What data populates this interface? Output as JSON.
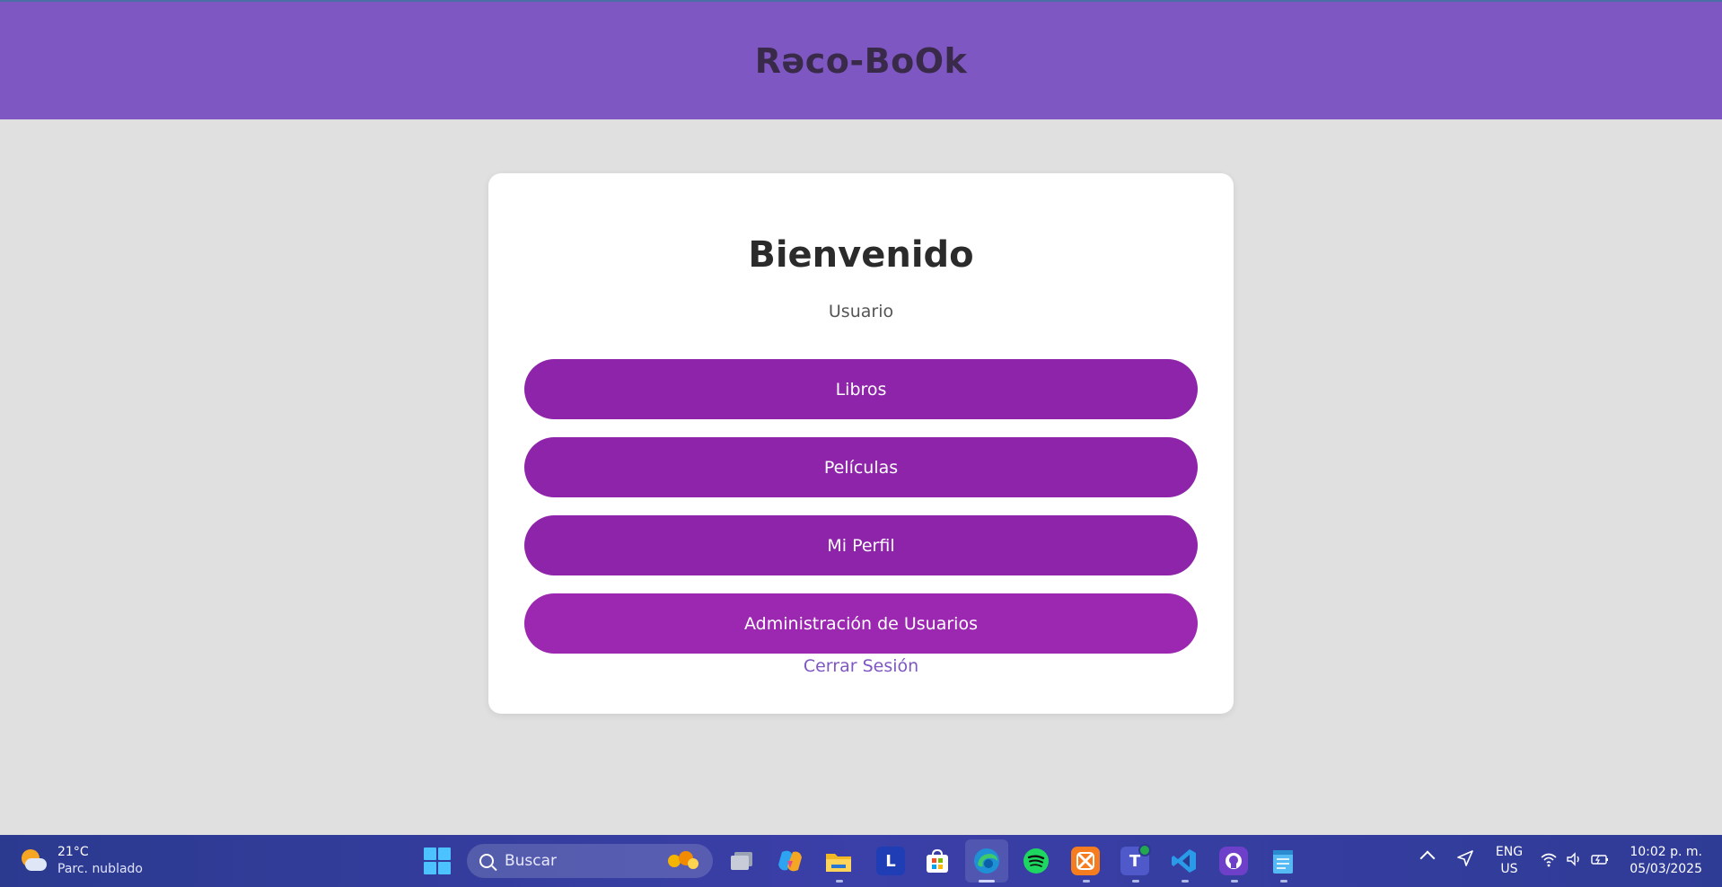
{
  "header": {
    "title": "Rəco-BoOk"
  },
  "card": {
    "title": "Bienvenido",
    "subtitle": "Usuario",
    "buttons": [
      {
        "label": "Libros"
      },
      {
        "label": "Películas"
      },
      {
        "label": "Mi Perfil"
      },
      {
        "label": "Administración de Usuarios"
      }
    ],
    "logout_label": "Cerrar Sesión"
  },
  "colors": {
    "header_bg": "#7e57c2",
    "button_bg": "#8e24aa",
    "button_bg_alt": "#9c27b0",
    "link": "#7e57c2",
    "page_bg": "#e0e0e0"
  },
  "taskbar": {
    "weather": {
      "temp": "21°C",
      "desc": "Parc. nublado",
      "icon": "partly-cloudy-night-icon"
    },
    "search": {
      "placeholder": "Buscar"
    },
    "apps": [
      {
        "name": "task-view",
        "icon": "task-view-icon"
      },
      {
        "name": "copilot",
        "icon": "copilot-icon"
      },
      {
        "name": "file-explorer",
        "icon": "folder-icon"
      },
      {
        "name": "l-app",
        "icon": "l-app-icon",
        "glyph": "L"
      },
      {
        "name": "microsoft-store",
        "icon": "store-icon"
      },
      {
        "name": "edge",
        "icon": "edge-icon"
      },
      {
        "name": "spotify",
        "icon": "spotify-icon"
      },
      {
        "name": "xampp",
        "icon": "xampp-icon"
      },
      {
        "name": "teams",
        "icon": "teams-icon",
        "glyph": "T"
      },
      {
        "name": "vscode",
        "icon": "vscode-icon"
      },
      {
        "name": "github",
        "icon": "github-icon"
      },
      {
        "name": "notepad",
        "icon": "notepad-icon"
      }
    ],
    "language": {
      "line1": "ENG",
      "line2": "US"
    },
    "clock": {
      "time": "10:02 p. m.",
      "date": "05/03/2025"
    }
  }
}
